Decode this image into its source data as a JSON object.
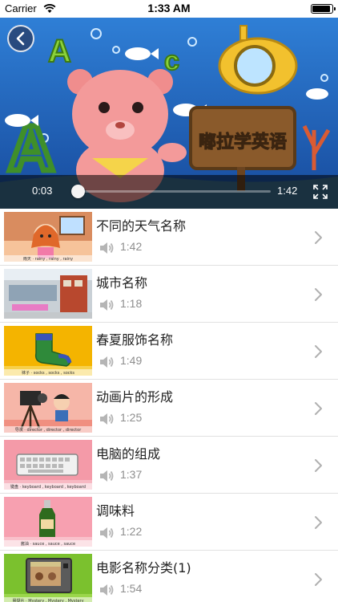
{
  "status_bar": {
    "carrier": "Carrier",
    "time": "1:33 AM"
  },
  "player": {
    "sign_text": "嘟拉学英语",
    "current_time": "0:03",
    "total_time": "1:42",
    "progress": 0.03
  },
  "lessons": [
    {
      "title": "不同的天气名称",
      "duration": "1:42",
      "caption": "雨天 · rainy , rainy , rainy"
    },
    {
      "title": "城市名称",
      "duration": "1:18",
      "caption": ""
    },
    {
      "title": "春夏服饰名称",
      "duration": "1:49",
      "caption": "袜子 · socks , socks , socks"
    },
    {
      "title": "动画片的形成",
      "duration": "1:25",
      "caption": "导演 · director , director , director"
    },
    {
      "title": "电脑的组成",
      "duration": "1:37",
      "caption": "键盘 · keyboard , keyboard , keyboard"
    },
    {
      "title": "调味料",
      "duration": "1:22",
      "caption": "酱油 · sauce , sauce , sauce"
    },
    {
      "title": "电影名称分类(1)",
      "duration": "1:54",
      "caption": "悬疑片 · Mystery , Mystery , Mystery"
    }
  ],
  "colors": {
    "text": "#222222",
    "muted": "#8e8e8e",
    "divider": "#e1e1e1",
    "sign_text": "#f4c542"
  },
  "icons": {
    "back": "chevron-left-icon",
    "fullscreen": "fullscreen-icon",
    "audio": "speaker-icon",
    "row": "chevron-right-icon"
  }
}
